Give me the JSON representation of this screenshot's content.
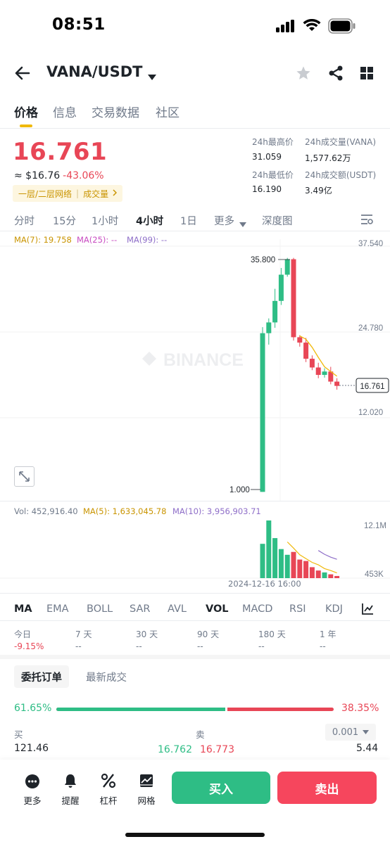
{
  "status_bar": {
    "time": "08:51"
  },
  "header": {
    "pair": "VANA/USDT"
  },
  "tabs": [
    {
      "label": "价格"
    },
    {
      "label": "信息"
    },
    {
      "label": "交易数据"
    },
    {
      "label": "社区"
    }
  ],
  "ticker": {
    "price": "16.761",
    "usd_price": "≈ $16.76",
    "change_pct": "-43.06%",
    "network_tag": "一层/二层网络",
    "volume_tag": "成交量"
  },
  "stats": {
    "high_label": "24h最高价",
    "high_value": "31.059",
    "vol_base_label": "24h成交量(VANA)",
    "vol_base_value": "1,577.62万",
    "low_label": "24h最低价",
    "low_value": "16.190",
    "vol_quote_label": "24h成交额(USDT)",
    "vol_quote_value": "3.49亿"
  },
  "timeframes": [
    "分时",
    "15分",
    "1小时",
    "4小时",
    "1日",
    "更多",
    "深度图"
  ],
  "ma": {
    "ma7": "MA(7): 19.758",
    "ma25": "MA(25): --",
    "ma99": "MA(99): --"
  },
  "price_axis": [
    "37.540",
    "24.780",
    "12.020"
  ],
  "current_price_tag": "16.761",
  "chart_labels": {
    "high": "35.800",
    "low": "1.000",
    "watermark": "BINANCE"
  },
  "volume_line": {
    "vol": "Vol: 452,916.40",
    "ma5": "MA(5): 1,633,045.78",
    "ma10": "MA(10): 3,956,903.71"
  },
  "volume_axis": [
    "12.1M",
    "453K"
  ],
  "time_label": "2024-12-16 16:00",
  "indicator_tabs": [
    "MA",
    "EMA",
    "BOLL",
    "SAR",
    "AVL",
    "VOL",
    "MACD",
    "RSI",
    "KDJ"
  ],
  "performance": [
    {
      "label": "今日",
      "value": "-9.15%"
    },
    {
      "label": "7 天",
      "value": "--"
    },
    {
      "label": "30 天",
      "value": "--"
    },
    {
      "label": "90 天",
      "value": "--"
    },
    {
      "label": "180 天",
      "value": "--"
    },
    {
      "label": "1 年",
      "value": "--"
    }
  ],
  "order_book": {
    "tab_orders": "委托订单",
    "tab_trades": "最新成交",
    "buy_pct": "61.65%",
    "sell_pct": "38.35%",
    "buy_ratio": 0.6165,
    "buy_label": "买",
    "sell_label": "卖",
    "precision": "0.001",
    "bid_qty": "121.46",
    "bid_price": "16.762",
    "ask_price": "16.773",
    "ask_qty": "5.44"
  },
  "bottom_bar": {
    "items": [
      "更多",
      "提醒",
      "杠杆",
      "网格"
    ],
    "buy": "买入",
    "sell": "卖出"
  },
  "colors": {
    "up": "#2ebd85",
    "down": "#e84656",
    "accent": "#f0b90b",
    "ma7": "#f0b90b",
    "ma25": "#c84bc1",
    "ma99": "#8e6ec8"
  },
  "chart_data": {
    "type": "candlestick",
    "interval": "4小时",
    "price_axis": [
      37.54,
      24.78,
      12.02
    ],
    "candles": [
      {
        "o": 1.0,
        "h": 25.5,
        "l": 1.0,
        "c": 24.6
      },
      {
        "o": 24.6,
        "h": 26.8,
        "l": 22.9,
        "c": 26.2
      },
      {
        "o": 26.2,
        "h": 31.2,
        "l": 25.4,
        "c": 29.4
      },
      {
        "o": 29.4,
        "h": 34.3,
        "l": 28.8,
        "c": 33.3
      },
      {
        "o": 33.3,
        "h": 35.8,
        "l": 33.0,
        "c": 35.6
      },
      {
        "o": 35.6,
        "h": 35.8,
        "l": 23.5,
        "c": 24.0
      },
      {
        "o": 24.0,
        "h": 24.3,
        "l": 22.6,
        "c": 23.2
      },
      {
        "o": 23.2,
        "h": 23.9,
        "l": 20.3,
        "c": 20.8
      },
      {
        "o": 20.8,
        "h": 21.3,
        "l": 19.1,
        "c": 19.5
      },
      {
        "o": 19.5,
        "h": 20.2,
        "l": 17.9,
        "c": 18.4
      },
      {
        "o": 18.4,
        "h": 19.4,
        "l": 18.0,
        "c": 18.9
      },
      {
        "o": 18.9,
        "h": 19.6,
        "l": 17.0,
        "c": 17.4
      },
      {
        "o": 17.4,
        "h": 17.9,
        "l": 16.2,
        "c": 16.76
      }
    ],
    "ma7": [
      null,
      null,
      null,
      null,
      null,
      null,
      24.2,
      23.7,
      22.5,
      21.0,
      19.6,
      18.9,
      18.2
    ],
    "volume": [
      7.2,
      12.1,
      8.4,
      6.1,
      4.9,
      5.5,
      3.9,
      3.6,
      2.3,
      1.6,
      1.2,
      0.8,
      0.453
    ],
    "volume_ma5": [
      null,
      null,
      null,
      null,
      7.6,
      6.3,
      4.9,
      4.1,
      3.3,
      2.8,
      2.0,
      1.6,
      1.1
    ],
    "volume_ma10": [
      null,
      null,
      null,
      null,
      null,
      null,
      null,
      null,
      null,
      5.8,
      5.0,
      4.4,
      3.96
    ],
    "volume_unit": "M",
    "volume_ylim": [
      0.453,
      12.1
    ]
  }
}
